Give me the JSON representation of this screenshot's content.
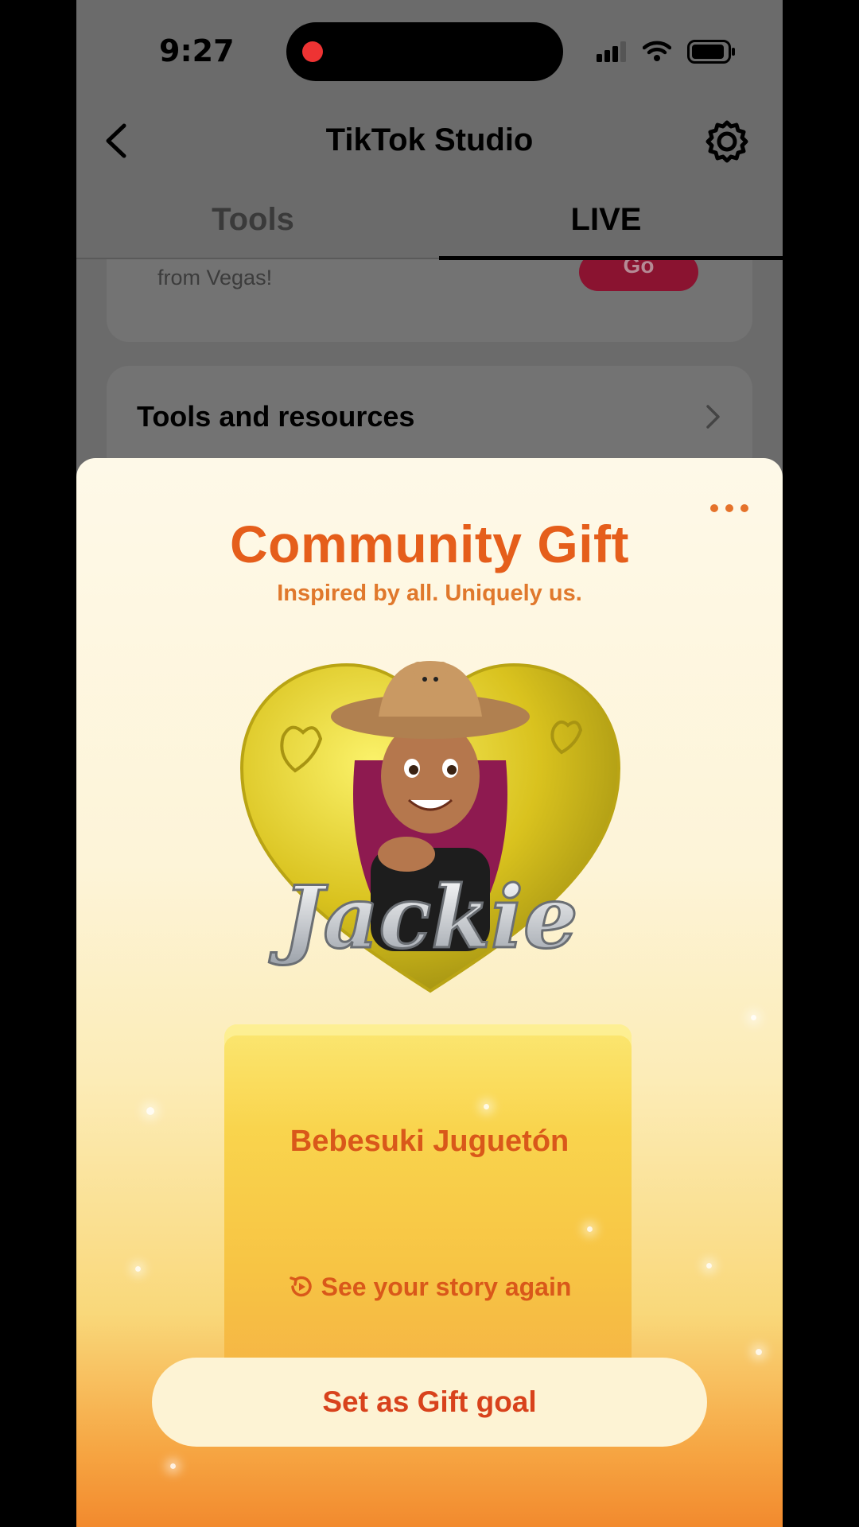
{
  "status_bar": {
    "time": "9:27"
  },
  "header": {
    "title": "TikTok Studio"
  },
  "tabs": [
    {
      "label": "Tools"
    },
    {
      "label": "LIVE",
      "active": true
    }
  ],
  "promo_card": {
    "text": "from Vegas!",
    "go_label": "Go"
  },
  "tools_card": {
    "label": "Tools and resources"
  },
  "gift_sheet": {
    "title": "Community Gift",
    "subtitle": "Inspired by all. Uniquely us.",
    "gift_name": "Jackie",
    "creator_name": "Bebesuki Juguetón",
    "story_link": "See your story again",
    "cta_label": "Set as Gift goal"
  },
  "colors": {
    "accent_orange": "#e55e1b",
    "cta_text": "#d8421c",
    "go_button": "#8a1330",
    "heart_gold": "#d9c21e"
  },
  "icons": [
    "back-arrow-icon",
    "gear-icon",
    "chevron-right-icon",
    "more-dots-icon",
    "replay-icon",
    "signal-icon",
    "wifi-icon",
    "battery-icon"
  ]
}
